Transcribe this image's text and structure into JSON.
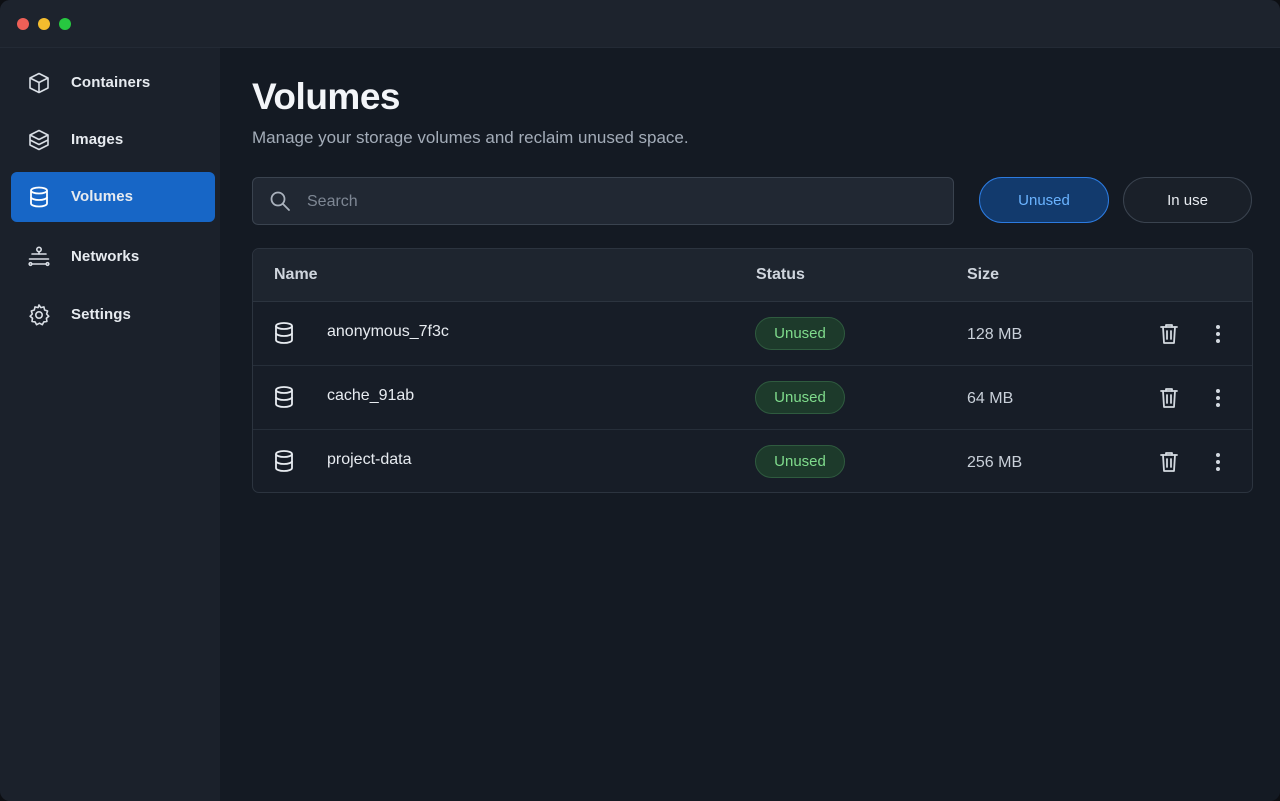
{
  "sidebar": {
    "items": [
      {
        "label": "Containers",
        "icon": "cube-icon",
        "active": false
      },
      {
        "label": "Images",
        "icon": "layers-cube-icon",
        "active": false
      },
      {
        "label": "Volumes",
        "icon": "database-icon",
        "active": true
      },
      {
        "label": "Networks",
        "icon": "network-icon",
        "active": false
      },
      {
        "label": "Settings",
        "icon": "gear-icon",
        "active": false
      }
    ]
  },
  "page": {
    "title": "Volumes",
    "subtitle": "Manage your storage volumes and reclaim unused space."
  },
  "search": {
    "placeholder": "Search",
    "value": ""
  },
  "filters": {
    "unused_label": "Unused",
    "in_use_label": "In use",
    "selected": "Unused"
  },
  "table": {
    "columns": [
      "Name",
      "Status",
      "Size"
    ],
    "rows": [
      {
        "name": "anonymous_7f3c",
        "status": "Unused",
        "size": "128 MB"
      },
      {
        "name": "cache_91ab",
        "status": "Unused",
        "size": "64 MB"
      },
      {
        "name": "project-data",
        "status": "Unused",
        "size": "256 MB"
      }
    ]
  },
  "colors": {
    "accent": "#1766c6",
    "status_unused_text": "#7fdb8c",
    "status_unused_bg": "#1d3a2b"
  }
}
